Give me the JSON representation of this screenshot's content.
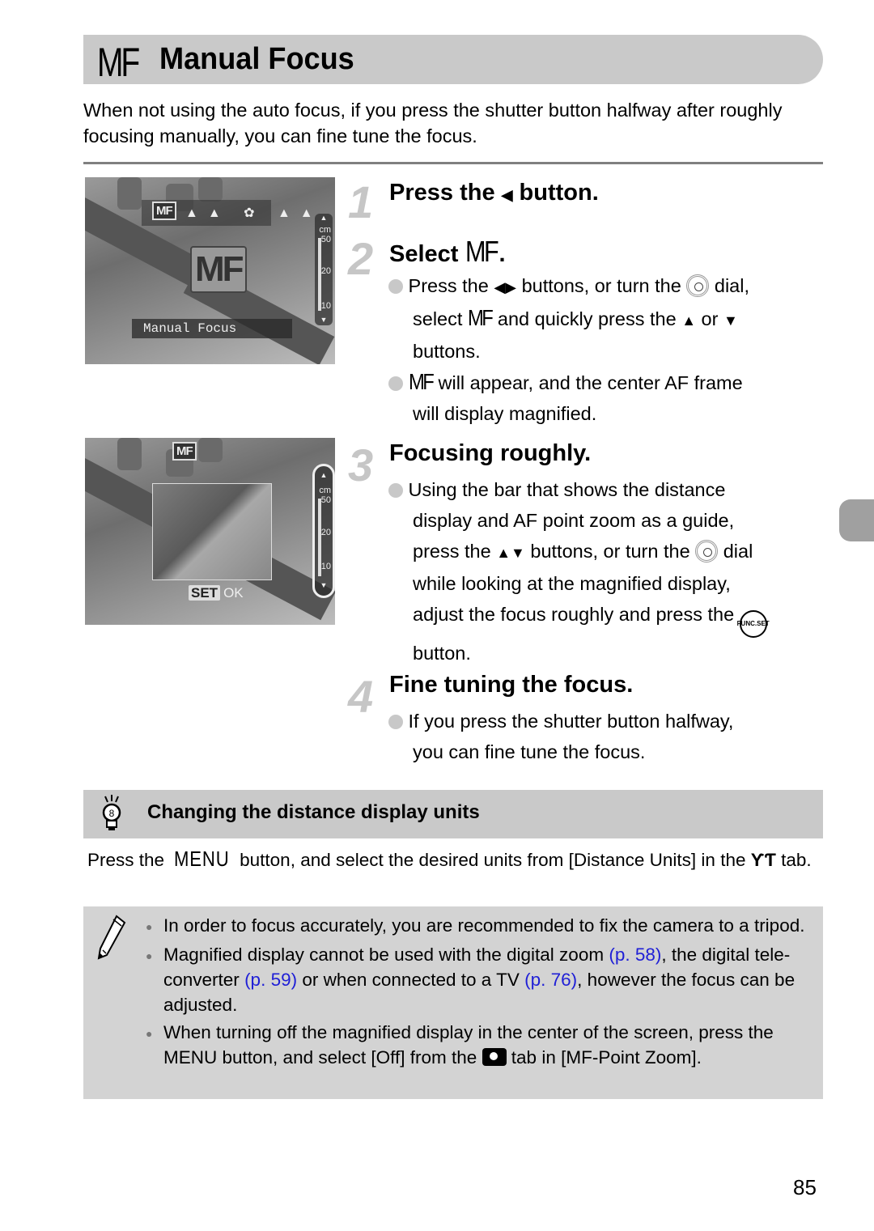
{
  "header": {
    "mf_symbol": "MF",
    "title": "Manual Focus"
  },
  "intro": "When not using the auto focus, if you press the shutter button halfway after roughly focusing manually, you can fine tune the focus.",
  "screens": {
    "screen1": {
      "mf_badge": "MF",
      "mode_icons": "▲▲ ✿ ▲▲",
      "scale_unit": "cm",
      "scale_marks": [
        "50",
        "20",
        "10"
      ],
      "big_badge": "MF",
      "caption": "Manual Focus"
    },
    "screen2": {
      "mf_badge": "MF",
      "scale_unit": "cm",
      "scale_marks": [
        "50",
        "20",
        "10"
      ],
      "set_label": "SET",
      "ok_label": "OK"
    }
  },
  "steps": [
    {
      "number": "1",
      "title_pre": "Press the",
      "title_icon": "◀",
      "title_post": "button."
    },
    {
      "number": "2",
      "title_pre": "Select",
      "title_mf": "MF",
      "title_post": ".",
      "bullets": [
        {
          "p1": "Press the",
          "icon1": "◀▶",
          "p2": "buttons, or turn the",
          "p3": "dial,",
          "p4": "select",
          "mf": "MF",
          "p5": "and quickly press the",
          "icon_up": "▲",
          "p6": "or",
          "icon_down": "▼",
          "p7": "buttons."
        },
        {
          "mf": "MF",
          "p1": "will appear, and the center AF frame",
          "p2": "will display magnified."
        }
      ]
    },
    {
      "number": "3",
      "title": "Focusing roughly.",
      "bullets": [
        {
          "l1": "Using the bar that shows the distance",
          "l2": "display and AF point zoom as a guide,",
          "l3a": "press the",
          "icon": "▲▼",
          "l3b": "buttons, or turn the",
          "l3c": "dial",
          "l4": "while looking at the magnified display,",
          "l5": "adjust the focus roughly and press the",
          "func_top": "FUNC.",
          "func_bottom": "SET",
          "l6": "button."
        }
      ]
    },
    {
      "number": "4",
      "title": "Fine tuning the focus.",
      "bullets": [
        {
          "l1": "If you press the shutter button halfway,",
          "l2": "you can fine tune the focus."
        }
      ]
    }
  ],
  "tip": {
    "title": "Changing the distance display units",
    "p1": "Press the",
    "menu": "MENU",
    "p2": "button, and select the desired units from [Distance Units] in the",
    "tab_icon": "ƳƬ",
    "p3": "tab."
  },
  "notes": [
    {
      "text": "In order to focus accurately, you are recommended to fix the camera to a tripod."
    },
    {
      "t1": "Magnified display cannot be used with the digital zoom",
      "link1": "(p. 58)",
      "t2": ", the digital tele-converter",
      "link2": "(p. 59)",
      "t3": "or when connected to a TV",
      "link3": "(p. 76)",
      "t4": ", however the focus can be adjusted."
    },
    {
      "t1": "When turning off the magnified display in the center of the screen, press the MENU button, and select [Off] from the",
      "t2": "tab in [MF-Point Zoom]."
    }
  ],
  "page_number": "85",
  "colors": {
    "title_bar": "#c9c9c9",
    "note_box": "#d3d3d3",
    "link": "#1f1fd6",
    "step_number": "#c6c6c6",
    "side_tab": "#a0a0a0"
  }
}
